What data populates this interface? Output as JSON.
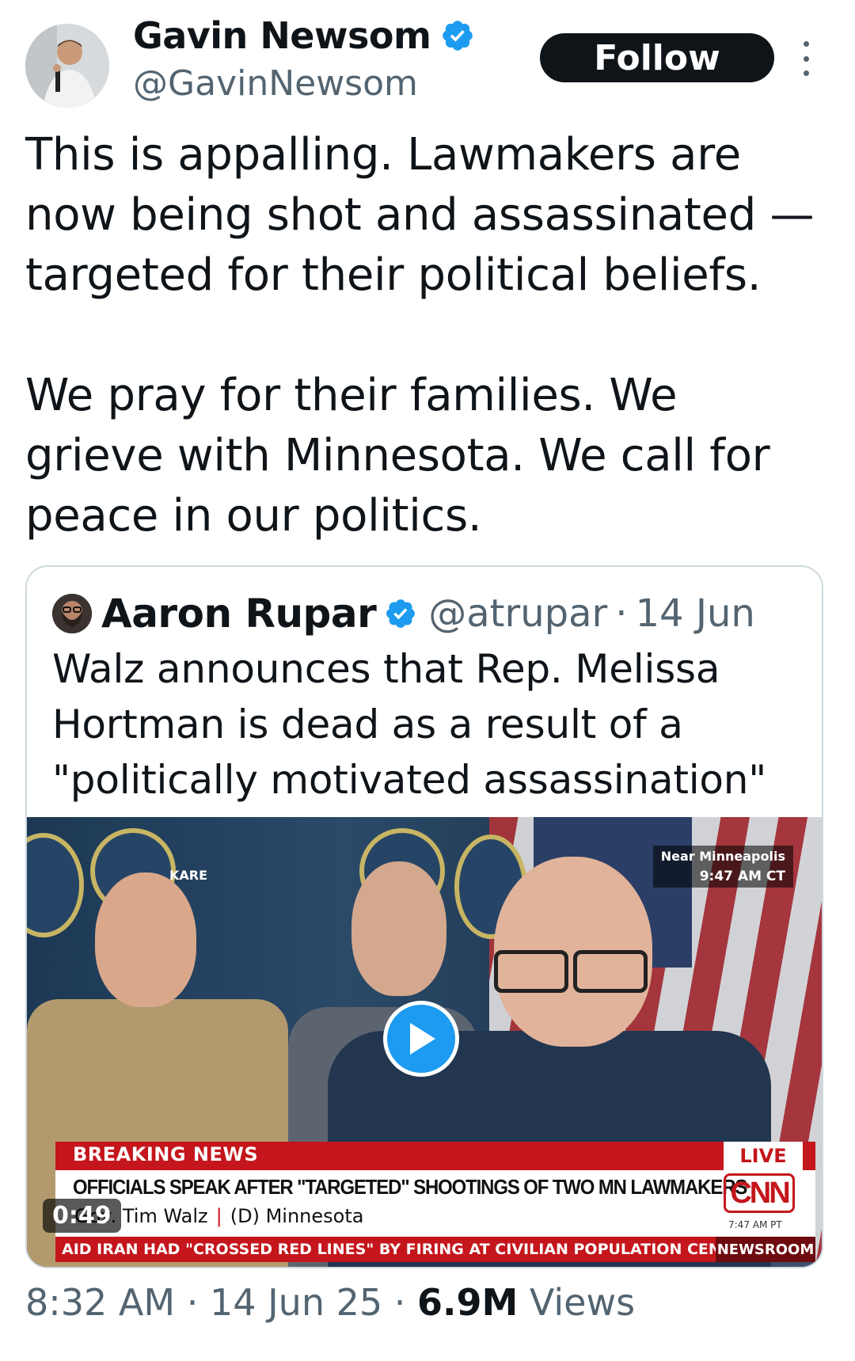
{
  "author": {
    "display_name": "Gavin Newsom",
    "handle": "@GavinNewsom",
    "verified_icon": "verified-badge-icon"
  },
  "actions": {
    "follow_label": "Follow",
    "more_icon": "more-vertical-icon"
  },
  "tweet": {
    "text": "This is appalling. Lawmakers are now being shot and assassinated — targeted for their political beliefs.\n\nWe pray for their families. We grieve with Minnesota. We call for peace in our politics."
  },
  "quote": {
    "display_name": "Aaron Rupar",
    "handle": "@atrupar",
    "separator": "·",
    "date": "14 Jun",
    "text": "Walz announces that Rep. Melissa Hortman is dead as a result of a \"politically motivated assassination\"",
    "video": {
      "duration": "0:49",
      "play_icon": "play-icon",
      "overlay": {
        "station": "KARE",
        "location": "Near Minneapolis",
        "local_time": "9:47 AM CT",
        "breaking_label": "BREAKING NEWS",
        "live_label": "LIVE",
        "headline": "OFFICIALS SPEAK AFTER \"TARGETED\" SHOOTINGS OF TWO MN LAWMAKERS",
        "speaker": "Gov. Tim Walz",
        "speaker_party": "(D) Minnesota",
        "network": "CNN",
        "network_time": "7:47 AM PT",
        "ticker": "AID IRAN HAD \"CROSSED RED LINES\" BY FIRING AT CIVILIAN POPULATION CENTERS, WHI",
        "program": "NEWSROOM"
      }
    }
  },
  "footer": {
    "time": "8:32 AM",
    "separator": "·",
    "date": "14 Jun 25",
    "views_count": "6.9M",
    "views_label": "Views"
  },
  "colors": {
    "verified": "#1d9bf0",
    "text_primary": "#0f1419",
    "text_secondary": "#536471",
    "cnn_red": "#c4161c"
  }
}
